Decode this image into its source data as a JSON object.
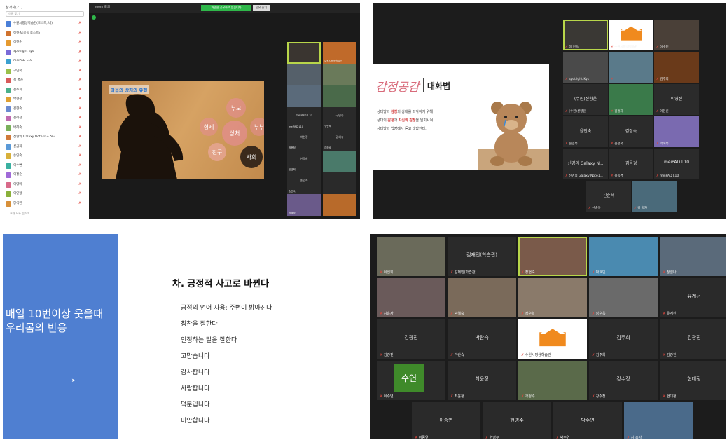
{
  "panel1": {
    "participants_header": "참가자(21)",
    "search_placeholder": "이름 찾기",
    "participants": [
      {
        "name": "수원시평생학습관(호스트, 나)",
        "color": "#4a7fd8"
      },
      {
        "name": "정현숙(공동 호스트)",
        "color": "#d0722e"
      },
      {
        "name": "이현순",
        "color": "#e59a2f"
      },
      {
        "name": "Spotlight Kys",
        "color": "#7a6ad8"
      },
      {
        "name": "meiPAD L10",
        "color": "#3aa0d0"
      },
      {
        "name": "구민숙",
        "color": "#9ac04a"
      },
      {
        "name": "김 홍자",
        "color": "#d85a5a"
      },
      {
        "name": "김주희",
        "color": "#4ab08a"
      },
      {
        "name": "박현정",
        "color": "#e0a030"
      },
      {
        "name": "김현숙",
        "color": "#6a8ad0"
      },
      {
        "name": "김혜선",
        "color": "#c06ab0"
      },
      {
        "name": "박혜숙",
        "color": "#7ab05a"
      },
      {
        "name": "신형의 Galaxy Note10+ 5G",
        "color": "#d07a3a"
      },
      {
        "name": "신금희",
        "color": "#5a9ad8"
      },
      {
        "name": "송인숙",
        "color": "#d8b03a"
      },
      {
        "name": "이수연",
        "color": "#3ab0a0"
      },
      {
        "name": "이정순",
        "color": "#a06ad8"
      },
      {
        "name": "이영미",
        "color": "#d86a8a"
      },
      {
        "name": "이인형",
        "color": "#8ab03a"
      },
      {
        "name": "장석란",
        "color": "#d8903a"
      }
    ],
    "footer": "초대    모두 음소거",
    "window_title": "zoom 회의",
    "share_banner": "화면을 공유하고 있습니다",
    "stop_share": "공유 중지",
    "slide_title": "마음의 상처의 유형",
    "bubbles": [
      "부모",
      "형제",
      "상처",
      "부부",
      "친구",
      "사회"
    ],
    "videos": [
      {
        "name": "",
        "sub": ""
      },
      {
        "name": "",
        "sub": "수원시평생학습관"
      },
      {
        "name": "",
        "sub": ""
      },
      {
        "name": "",
        "sub": ""
      },
      {
        "name": "",
        "sub": ""
      },
      {
        "name": "",
        "sub": ""
      },
      {
        "name": "meiPAD L10",
        "sub": "meiPAD L10"
      },
      {
        "name": "구민숙",
        "sub": "구민숙"
      },
      {
        "name": "박현정",
        "sub": "박현정"
      },
      {
        "name": "김혜숙",
        "sub": "김혜숙"
      },
      {
        "name": "신금희",
        "sub": "신금희"
      },
      {
        "name": "",
        "sub": ""
      },
      {
        "name": "송인숙",
        "sub": "송인숙"
      },
      {
        "name": "",
        "sub": ""
      },
      {
        "name": "",
        "sub": "박혜숙"
      },
      {
        "name": "",
        "sub": ""
      }
    ]
  },
  "panel2": {
    "title_script": "감정공감",
    "title_main": "대화법",
    "lines": [
      {
        "pre": "상대방의 ",
        "hl1": "감정",
        "mid": "의 상태를 파악하기 위해",
        "hl2": "",
        "post": ""
      },
      {
        "pre": "상대의 ",
        "hl1": "감정",
        "mid": "과 ",
        "hl2": "자신의 감정",
        "post": "을 일치시켜"
      },
      {
        "pre": "상대방의 입장에서 듣고 대답한다.",
        "hl1": "",
        "mid": "",
        "hl2": "",
        "post": ""
      }
    ],
    "tiles": [
      {
        "name": "",
        "sub": "정 현숙"
      },
      {
        "name": "",
        "sub": "수원시평생학습관"
      },
      {
        "name": "",
        "sub": "이수연"
      },
      {
        "name": "",
        "sub": "spotlight Kys"
      },
      {
        "name": "",
        "sub": ""
      },
      {
        "name": "",
        "sub": "김주희"
      },
      {
        "name": "(수원)신향윤",
        "sub": "(수원)신향윤"
      },
      {
        "name": "",
        "sub": "김홍자"
      },
      {
        "name": "이영신",
        "sub": "이현신"
      },
      {
        "name": "윤민숙",
        "sub": "윤민숙"
      },
      {
        "name": "김정숙",
        "sub": "김정숙"
      },
      {
        "name": "",
        "sub": "박혜숙"
      },
      {
        "name": "신영의 Galaxy N...",
        "sub": "신영의 Galaxy Note1..."
      },
      {
        "name": "김옥경",
        "sub": "김옥경"
      },
      {
        "name": "meiPAD L10",
        "sub": "meiPAD L10"
      },
      {
        "name": "신순옥",
        "sub": "신순옥"
      },
      {
        "name": "",
        "sub": "김 홍자"
      }
    ]
  },
  "panel3": {
    "blue_text": "매일 10번이상 웃을때\n우리몸의 반응",
    "heading": "차. 긍정적 사고로 바뀐다",
    "items": [
      "긍정의 언어 사용: 주변이 밝아진다",
      "칭찬을 잘한다",
      "인정하는 말을 잘한다",
      "고맙습니다",
      "감사합니다",
      "사랑합니다",
      "덕분입니다",
      "미안합니다"
    ]
  },
  "panel4": {
    "tiles": [
      {
        "name": "",
        "sub": "이선희"
      },
      {
        "name": "김재민(학습관)",
        "sub": "김재민(학습관)"
      },
      {
        "name": "",
        "sub": "정현숙"
      },
      {
        "name": "",
        "sub": "박효민"
      },
      {
        "name": "",
        "sub": "정일나"
      },
      {
        "name": "",
        "sub": "김홍자"
      },
      {
        "name": "",
        "sub": "박혜숙"
      },
      {
        "name": "",
        "sub": "정순희"
      },
      {
        "name": "",
        "sub": "장순옥"
      },
      {
        "name": "유계선",
        "sub": "유계선"
      },
      {
        "name": "김광진",
        "sub": "김광진"
      },
      {
        "name": "박란숙",
        "sub": "박란숙"
      },
      {
        "name": "",
        "sub": "수원시평생학습관"
      },
      {
        "name": "김주희",
        "sub": "김주희"
      },
      {
        "name": "김광진",
        "sub": "김광진"
      },
      {
        "name": "",
        "sub": "이수연"
      },
      {
        "name": "최윤정",
        "sub": "최윤정"
      },
      {
        "name": "",
        "sub": "곽정수"
      },
      {
        "name": "강수정",
        "sub": "강수정"
      },
      {
        "name": "현대정",
        "sub": "현대정"
      },
      {
        "name": "이종연",
        "sub": "이종연"
      },
      {
        "name": "현영주",
        "sub": "현영주"
      },
      {
        "name": "박수연",
        "sub": "박수연"
      },
      {
        "name": "",
        "sub": "김 홍자"
      }
    ],
    "sooyeon_label": "수연"
  },
  "colors": {
    "zoom_dark": "#1c1c1c",
    "active_speaker": "#b8d64a",
    "muted_red": "#e0463c",
    "slide_blue": "#4f7fd1",
    "share_green": "#2fb84a"
  }
}
